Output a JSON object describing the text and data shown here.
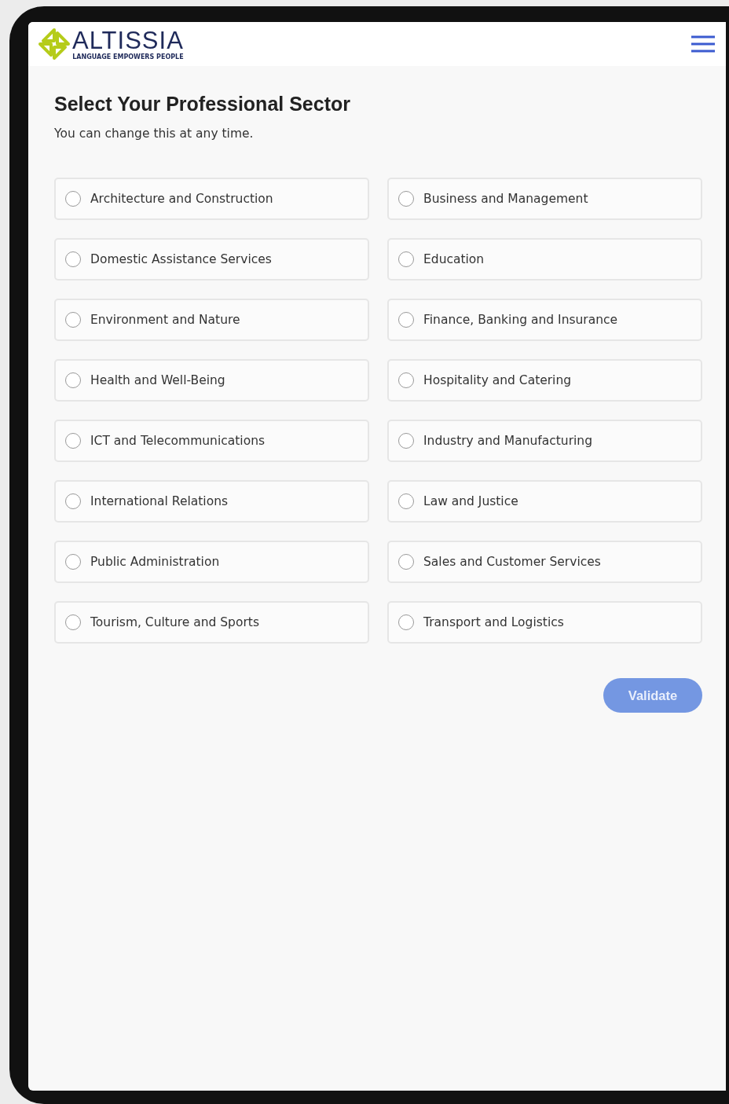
{
  "header": {
    "logo": {
      "name": "ALTISSIA",
      "tagline": "LANGUAGE EMPOWERS PEOPLE"
    }
  },
  "title": "Select Your Professional Sector",
  "subtitle": "You can change this at any time.",
  "sectors": [
    {
      "label": "Architecture and Construction",
      "selected": false
    },
    {
      "label": "Business and Management",
      "selected": false
    },
    {
      "label": "Domestic Assistance Services",
      "selected": false
    },
    {
      "label": "Education",
      "selected": false
    },
    {
      "label": "Environment and Nature",
      "selected": false
    },
    {
      "label": "Finance, Banking and Insurance",
      "selected": false
    },
    {
      "label": "Health and Well-Being",
      "selected": false
    },
    {
      "label": "Hospitality and Catering",
      "selected": false
    },
    {
      "label": "ICT and Telecommunications",
      "selected": false
    },
    {
      "label": "Industry and Manufacturing",
      "selected": false
    },
    {
      "label": "International Relations",
      "selected": false
    },
    {
      "label": "Law and Justice",
      "selected": false
    },
    {
      "label": "Public Administration",
      "selected": false
    },
    {
      "label": "Sales and Customer Services",
      "selected": false
    },
    {
      "label": "Tourism, Culture and Sports",
      "selected": false
    },
    {
      "label": "Transport and Logistics",
      "selected": false
    }
  ],
  "validate_button": {
    "label": "Validate",
    "disabled": true
  }
}
